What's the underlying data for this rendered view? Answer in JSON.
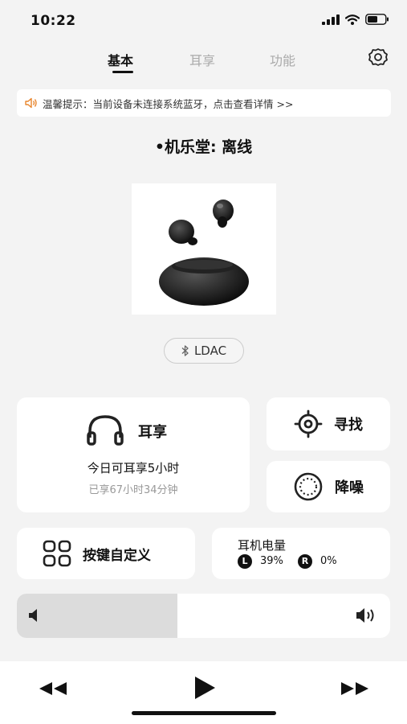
{
  "status": {
    "time": "10:22"
  },
  "tabs": [
    {
      "label": "基本",
      "active": true
    },
    {
      "label": "耳享",
      "active": false
    },
    {
      "label": "功能",
      "active": false
    }
  ],
  "notice": {
    "text": "温馨提示：当前设备未连接系统蓝牙，点击查看详情 >>"
  },
  "device": {
    "status": "•机乐堂: 离线"
  },
  "codec": {
    "label": "LDAC"
  },
  "earshare": {
    "title": "耳享",
    "today": "今日可耳享5小时",
    "used": "已享67小时34分钟"
  },
  "find": {
    "label": "寻找"
  },
  "anc": {
    "label": "降噪"
  },
  "keys": {
    "label": "按键自定义"
  },
  "battery": {
    "title": "耳机电量",
    "left_badge": "L",
    "left_value": "39%",
    "right_badge": "R",
    "right_value": "0%"
  },
  "volume": {
    "level": 0.43
  },
  "colors": {
    "accent": "#e8852d",
    "background": "#f3f3f3",
    "card": "#ffffff"
  }
}
